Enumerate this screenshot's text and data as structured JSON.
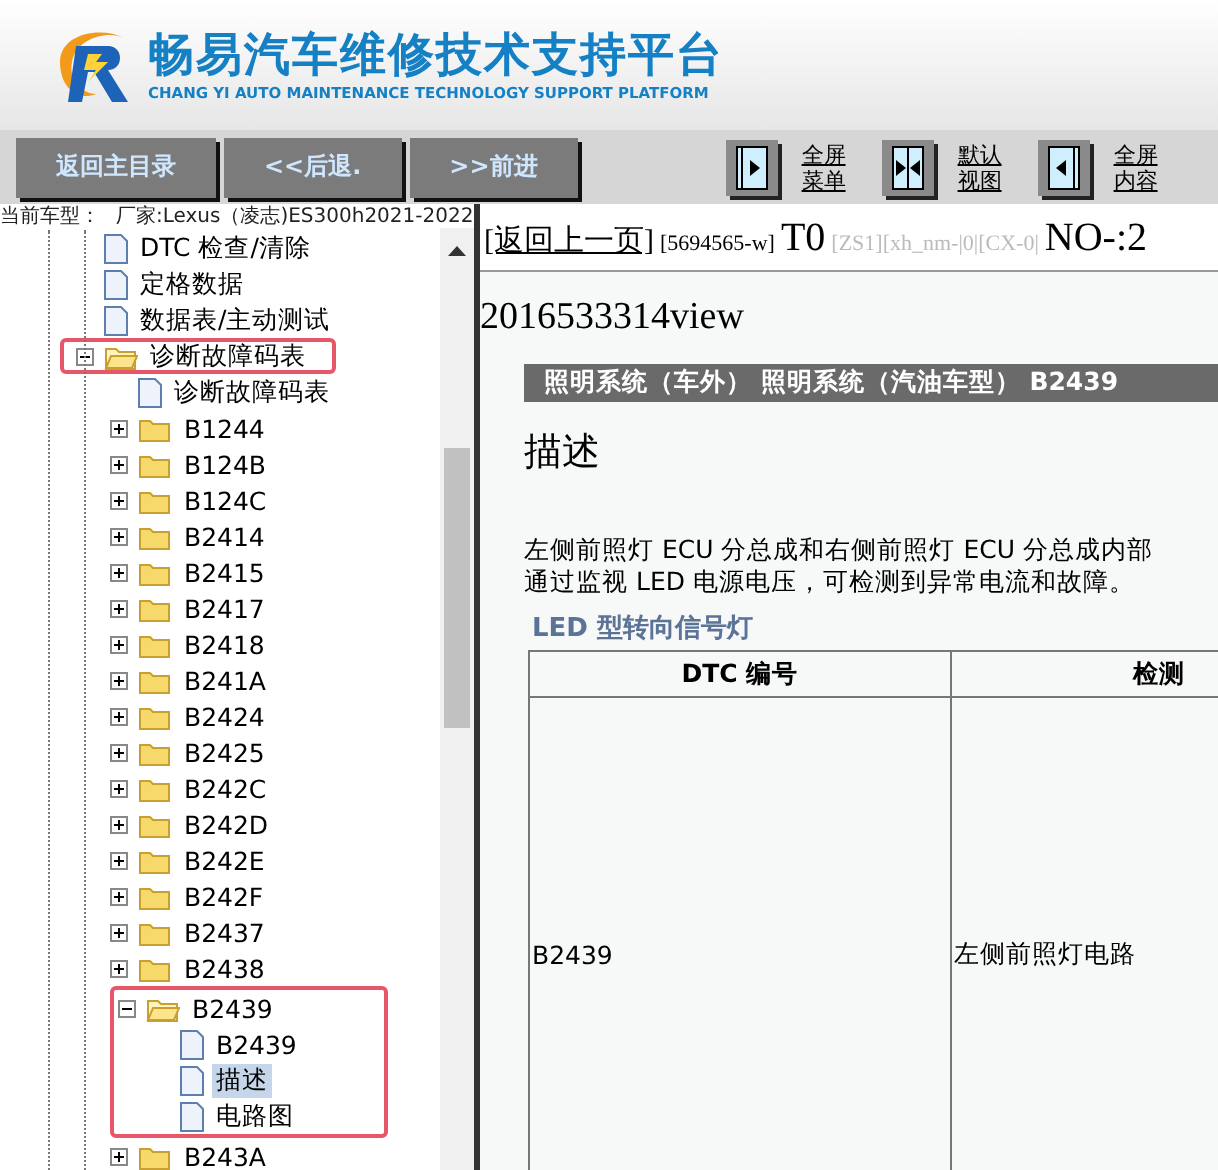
{
  "header": {
    "title": "畅易汽车维修技术支持平台",
    "subtitle": "CHANG YI AUTO MAINTENANCE TECHNOLOGY SUPPORT PLATFORM"
  },
  "toolbar": {
    "nav_buttons": [
      "返回主目录",
      "<<后退.",
      ">>前进"
    ],
    "view_buttons": [
      {
        "kind": "menu",
        "lines": [
          "全屏",
          "菜单"
        ]
      },
      {
        "kind": "default",
        "lines": [
          "默认",
          "视图"
        ]
      },
      {
        "kind": "content",
        "lines": [
          "全屏",
          "内容"
        ]
      }
    ]
  },
  "vehicle": {
    "label": "当前车型：",
    "value": "厂家:Lexus（凌志)ES300h2021-2022"
  },
  "tree": [
    {
      "label": "DTC 检查/清除",
      "kind": "page",
      "selected": false
    },
    {
      "label": "定格数据",
      "kind": "page",
      "selected": false
    },
    {
      "label": "数据表/主动测试",
      "kind": "page",
      "selected": false
    },
    {
      "label": "诊断故障码表",
      "kind": "folder",
      "expanded": true,
      "selected": false,
      "highlighted": true,
      "children": [
        {
          "label": "诊断故障码表",
          "kind": "page",
          "selected": false
        },
        {
          "label": "B1244",
          "kind": "folder",
          "expanded": false,
          "selected": false
        },
        {
          "label": "B124B",
          "kind": "folder",
          "expanded": false,
          "selected": false
        },
        {
          "label": "B124C",
          "kind": "folder",
          "expanded": false,
          "selected": false
        },
        {
          "label": "B2414",
          "kind": "folder",
          "expanded": false,
          "selected": false
        },
        {
          "label": "B2415",
          "kind": "folder",
          "expanded": false,
          "selected": false
        },
        {
          "label": "B2417",
          "kind": "folder",
          "expanded": false,
          "selected": false
        },
        {
          "label": "B2418",
          "kind": "folder",
          "expanded": false,
          "selected": false
        },
        {
          "label": "B241A",
          "kind": "folder",
          "expanded": false,
          "selected": false
        },
        {
          "label": "B2424",
          "kind": "folder",
          "expanded": false,
          "selected": false
        },
        {
          "label": "B2425",
          "kind": "folder",
          "expanded": false,
          "selected": false
        },
        {
          "label": "B242C",
          "kind": "folder",
          "expanded": false,
          "selected": false
        },
        {
          "label": "B242D",
          "kind": "folder",
          "expanded": false,
          "selected": false
        },
        {
          "label": "B242E",
          "kind": "folder",
          "expanded": false,
          "selected": false
        },
        {
          "label": "B242F",
          "kind": "folder",
          "expanded": false,
          "selected": false
        },
        {
          "label": "B2437",
          "kind": "folder",
          "expanded": false,
          "selected": false
        },
        {
          "label": "B2438",
          "kind": "folder",
          "expanded": false,
          "selected": false
        },
        {
          "label": "B2439",
          "kind": "folder",
          "expanded": true,
          "selected": false,
          "highlighted": true,
          "children": [
            {
              "label": "B2439",
              "kind": "page",
              "selected": false,
              "highlighted": true
            },
            {
              "label": "描述",
              "kind": "page",
              "selected": true,
              "highlighted": true
            },
            {
              "label": "电路图",
              "kind": "page",
              "selected": false,
              "highlighted": true
            }
          ]
        },
        {
          "label": "B243A",
          "kind": "folder",
          "expanded": false,
          "selected": false
        }
      ]
    }
  ],
  "content": {
    "back_link": "[返回上一页]",
    "id_tag": "[5694565-w]",
    "t_code": "T0",
    "debug_tag": "[ZS1][xh_nm-|0|[CX-0|",
    "number": "NO-:2",
    "view_id": "2016533314view",
    "breadcrumb": "照明系统（车外） 照明系统（汽油车型） B2439",
    "heading": "描述",
    "paragraph": [
      "左侧前照灯 ECU 分总成和右侧前照灯 ECU 分总成内部",
      "通过监视 LED 电源电压，可检测到异常电流和故障。"
    ],
    "subheading": "LED 型转向信号灯",
    "table": {
      "columns": [
        "DTC 编号",
        "检测"
      ],
      "rows": [
        [
          "B2439",
          "左侧前照灯电路"
        ]
      ]
    }
  }
}
